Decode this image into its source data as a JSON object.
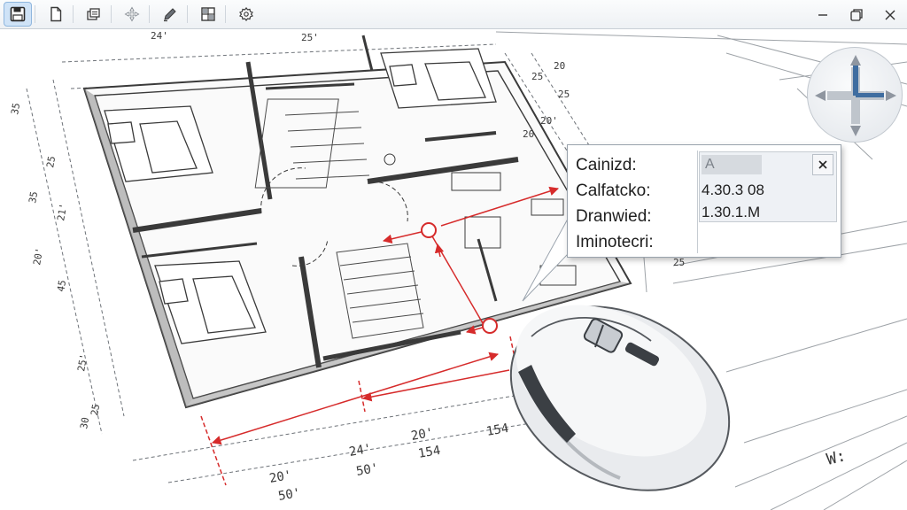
{
  "toolbar": {
    "tools": [
      {
        "icon": "save-icon",
        "active": true
      },
      {
        "icon": "new-document-icon"
      },
      {
        "icon": "layers-icon"
      },
      {
        "icon": "move-icon"
      },
      {
        "icon": "pencil-icon"
      },
      {
        "icon": "grid-icon"
      },
      {
        "icon": "settings-icon"
      }
    ],
    "window_controls": [
      "minimize-icon",
      "maximize-icon",
      "close-icon"
    ]
  },
  "drawing": {
    "dimensions": [
      "24'",
      "25'",
      "35",
      "35",
      "20'",
      "45",
      "21'",
      "25'",
      "25",
      "25",
      "25",
      "20'",
      "20",
      "20",
      "25",
      "25",
      "30",
      "25",
      "20'",
      "50'",
      "24'",
      "50'",
      "20'",
      "154",
      "154"
    ],
    "title_block_text": "W:"
  },
  "tooltip": {
    "labels": [
      "Cainizd:",
      "Calfatcko:",
      "Dranwied:",
      "Iminotecri:"
    ],
    "field_value": "A",
    "values": [
      "4.30.3  08",
      "1.30.1.M"
    ]
  },
  "colors": {
    "dimension_red": "#d62b2b",
    "line_dark": "#3a3a3a",
    "wall_gray": "#8a8a8a",
    "toolbar_active": "#cfe3f7"
  }
}
